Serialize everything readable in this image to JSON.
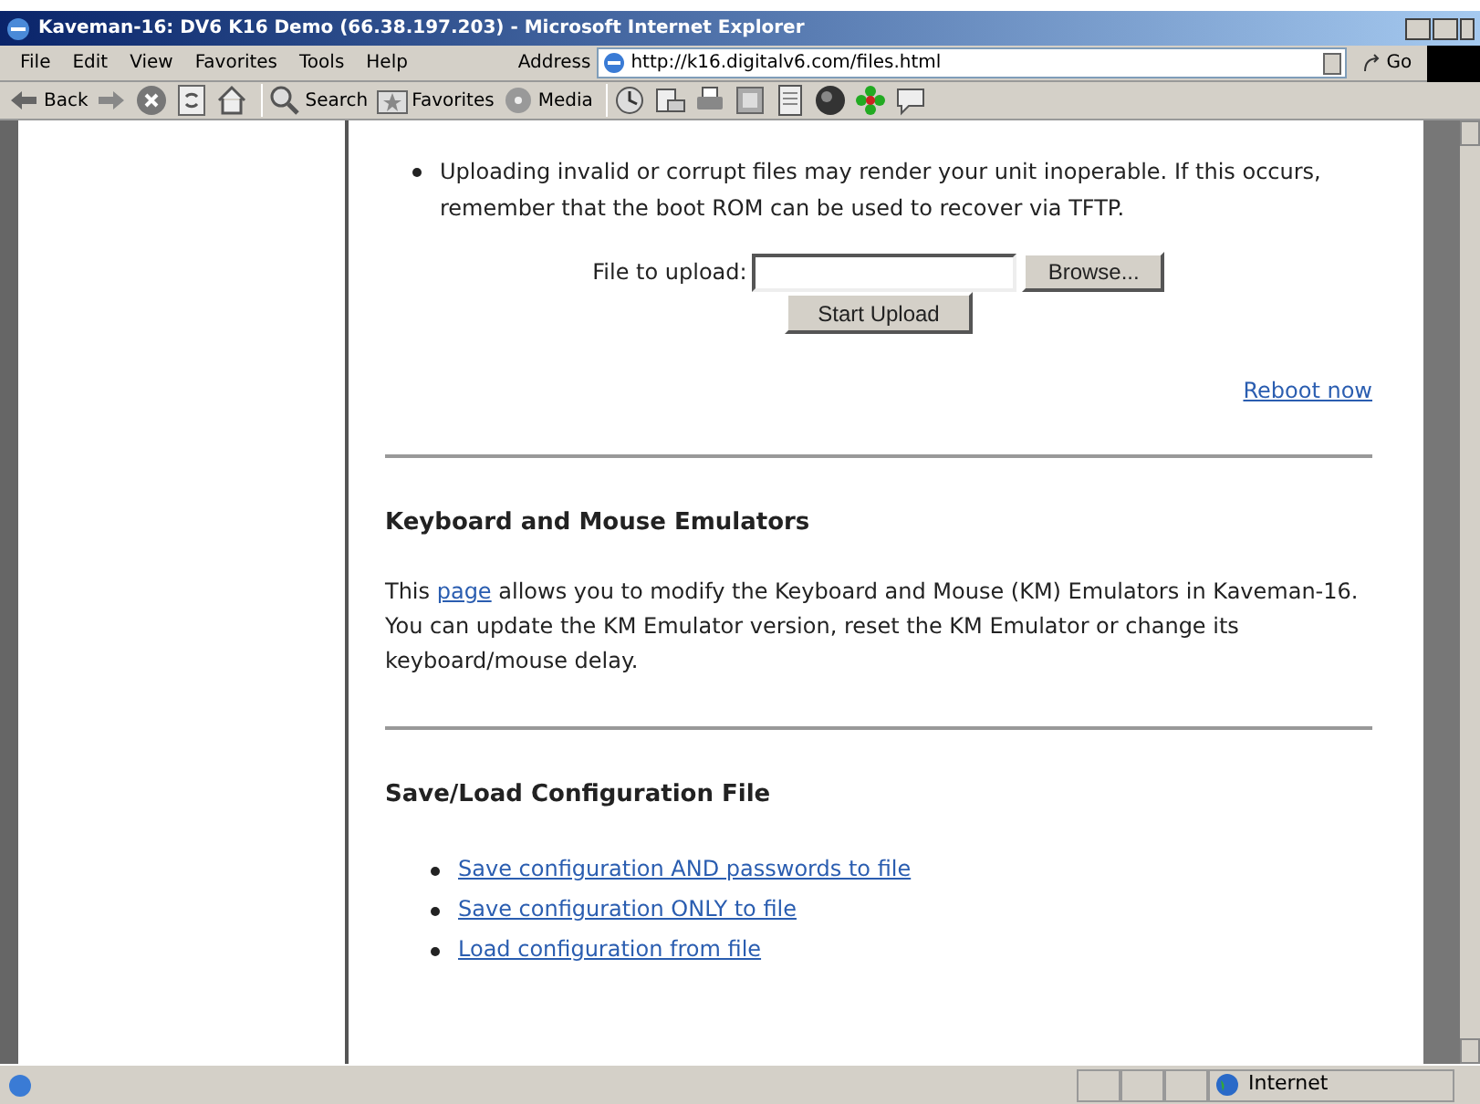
{
  "window": {
    "title": "Kaveman-16: DV6 K16 Demo (66.38.197.203) - Microsoft Internet Explorer"
  },
  "menu": [
    "File",
    "Edit",
    "View",
    "Favorites",
    "Tools",
    "Help"
  ],
  "address": {
    "label": "Address",
    "value": "http://k16.digitalv6.com/files.html",
    "go": "Go"
  },
  "toolbar": [
    {
      "kind": "back",
      "label": "Back"
    },
    {
      "kind": "forward"
    },
    {
      "kind": "stop"
    },
    {
      "kind": "refresh"
    },
    {
      "kind": "home"
    },
    {
      "kind": "search",
      "label": "Search"
    },
    {
      "kind": "favorites",
      "label": "Favorites"
    },
    {
      "kind": "media",
      "label": "Media"
    },
    {
      "kind": "history"
    },
    {
      "kind": "mail"
    },
    {
      "kind": "print"
    },
    {
      "kind": "edit"
    },
    {
      "kind": "discuss"
    },
    {
      "kind": "messenger"
    },
    {
      "kind": "flower"
    },
    {
      "kind": "chat"
    }
  ],
  "content": {
    "bullet": "Uploading invalid or corrupt files may render your unit inoperable. If this occurs, remember that the boot ROM can be used to recover via TFTP.",
    "upload": {
      "label": "File to upload:",
      "browse": "Browse...",
      "submit": "Start Upload"
    },
    "reboot": "Reboot now",
    "sections": [
      {
        "heading": "Keyboard and Mouse Emulators",
        "before": "This ",
        "link": "page",
        "after": " allows you to modify the Keyboard and Mouse (KM) Emulators in Kaveman-16. You can update the KM Emulator version, reset the KM Emulator or change its keyboard/mouse delay."
      },
      {
        "heading": "Save/Load Configuration File",
        "links": [
          "Save configuration AND passwords to file",
          "Save configuration ONLY to file",
          "Load configuration from file"
        ]
      }
    ]
  },
  "status": {
    "zone": "Internet"
  }
}
